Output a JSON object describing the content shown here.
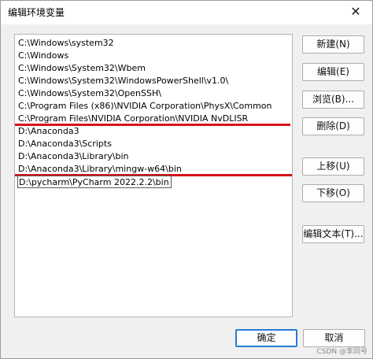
{
  "window": {
    "title": "编辑环境变量",
    "close_glyph": "✕"
  },
  "list": {
    "items": [
      "C:\\Windows\\system32",
      "C:\\Windows",
      "C:\\Windows\\System32\\Wbem",
      "C:\\Windows\\System32\\WindowsPowerShell\\v1.0\\",
      "C:\\Windows\\System32\\OpenSSH\\",
      "C:\\Program Files (x86)\\NVIDIA Corporation\\PhysX\\Common",
      "C:\\Program Files\\NVIDIA Corporation\\NVIDIA NvDLISR",
      "D:\\Anaconda3",
      "D:\\Anaconda3\\Scripts",
      "D:\\Anaconda3\\Library\\bin",
      "D:\\Anaconda3\\Library\\mingw-w64\\bin",
      "D:\\pycharm\\PyCharm 2022.2.2\\bin"
    ],
    "editing_index": 11
  },
  "buttons": {
    "new": "新建(N)",
    "edit": "编辑(E)",
    "browse": "浏览(B)...",
    "delete": "删除(D)",
    "move_up": "上移(U)",
    "move_down": "下移(O)",
    "edit_text": "编辑文本(T)...",
    "ok": "确定",
    "cancel": "取消"
  },
  "annotation_color": "#d4141a",
  "watermark": "CSDN @李同号"
}
